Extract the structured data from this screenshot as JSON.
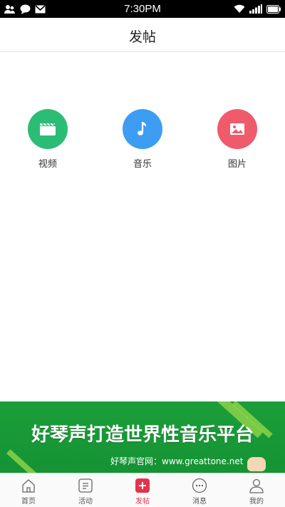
{
  "status_bar": {
    "time": "7:30PM"
  },
  "header": {
    "title": "发帖"
  },
  "post_types": [
    {
      "label": "视频",
      "icon": "video-icon",
      "color": "#2bbd76"
    },
    {
      "label": "音乐",
      "icon": "music-note-icon",
      "color": "#3d9df2"
    },
    {
      "label": "图片",
      "icon": "image-icon",
      "color": "#ef5b6a"
    }
  ],
  "banner": {
    "headline": "好琴声打造世界性音乐平台",
    "subline": "好琴声官网：www.greattone.net"
  },
  "tabs": [
    {
      "label": "首页",
      "icon": "home-icon"
    },
    {
      "label": "活动",
      "icon": "list-icon"
    },
    {
      "label": "发帖",
      "icon": "plus-icon",
      "active": true
    },
    {
      "label": "消息",
      "icon": "chat-icon"
    },
    {
      "label": "我的",
      "icon": "user-icon"
    }
  ],
  "colors": {
    "accent": "#e2344a",
    "banner_green": "#1b9e3a"
  }
}
